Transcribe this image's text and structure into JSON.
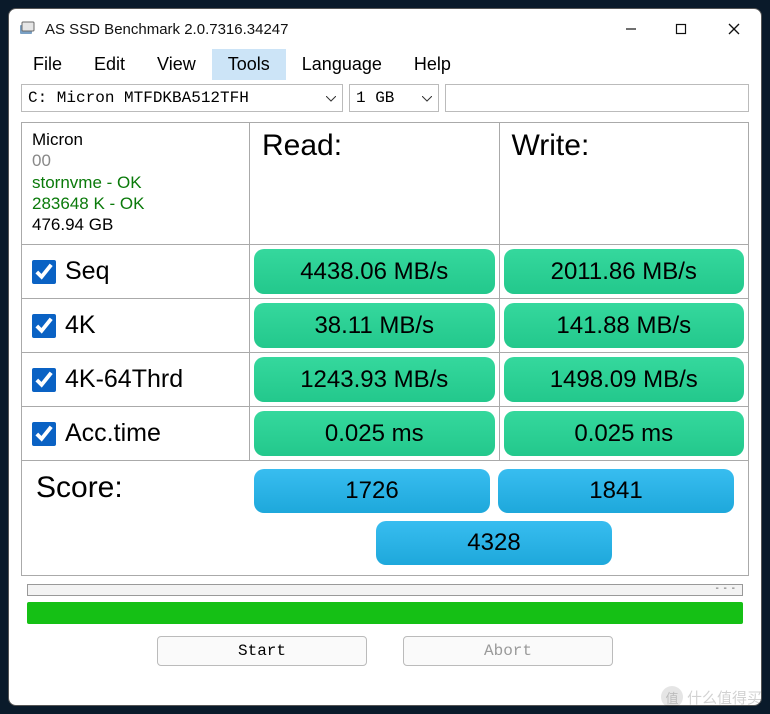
{
  "window": {
    "title": "AS SSD Benchmark 2.0.7316.34247"
  },
  "menu": {
    "items": [
      "File",
      "Edit",
      "View",
      "Tools",
      "Language",
      "Help"
    ],
    "selected_index": 3
  },
  "selectors": {
    "drive": "C: Micron MTFDKBA512TFH",
    "size": "1 GB"
  },
  "info": {
    "vendor": "Micron",
    "serial": "00",
    "driver": "stornvme - OK",
    "align": "283648 K - OK",
    "capacity": "476.94 GB"
  },
  "headers": {
    "read": "Read:",
    "write": "Write:"
  },
  "rows": {
    "seq": {
      "label": "Seq",
      "checked": true,
      "read": "4438.06 MB/s",
      "write": "2011.86 MB/s"
    },
    "fourk": {
      "label": "4K",
      "checked": true,
      "read": "38.11 MB/s",
      "write": "141.88 MB/s"
    },
    "fourk64": {
      "label": "4K-64Thrd",
      "checked": true,
      "read": "1243.93 MB/s",
      "write": "1498.09 MB/s"
    },
    "acc": {
      "label": "Acc.time",
      "checked": true,
      "read": "0.025 ms",
      "write": "0.025 ms"
    }
  },
  "score": {
    "label": "Score:",
    "read": "1726",
    "write": "1841",
    "total": "4328"
  },
  "buttons": {
    "start": "Start",
    "abort": "Abort"
  },
  "watermark": "什么值得买"
}
